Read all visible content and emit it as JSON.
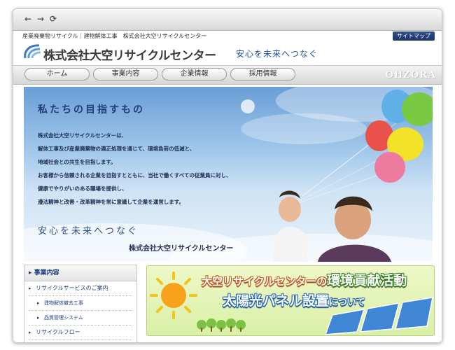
{
  "browser": {
    "back_icon": "arrow-left-icon",
    "forward_icon": "arrow-right-icon",
    "reload_icon": "reload-icon"
  },
  "header": {
    "tagline": "産業廃棄物リサイクル｜建物解体工事　株式会社大空リサイクルセンター",
    "sitemap_label": "サイトマップ",
    "company_name": "株式会社大空リサイクルセンター",
    "slogan": "安心を未来へつなぐ",
    "brand_logo_text": "OHZORA"
  },
  "nav": {
    "items": [
      {
        "label": "ホーム"
      },
      {
        "label": "事業内容"
      },
      {
        "label": "企業情報"
      },
      {
        "label": "採用情報"
      }
    ]
  },
  "hero": {
    "title": "私たちの目指すもの",
    "lines": [
      "株式会社大空リサイクルセンターは、",
      "解体工事及び産業廃棄物の適正処理を通じて、環境負荷の低減と、",
      "地域社会との共生を目指します。",
      "お客様から信頼される企業を目指すとともに、当社で働くすべての従業員に対し、",
      "健康でやりがいのある職場を提供し、",
      "遵法精神と改善・改革精神を常に意識して企業を運営します。"
    ],
    "slogan": "安心を未来へつなぐ",
    "company": "株式会社大空リサイクルセンター"
  },
  "sidebar": {
    "heading": "事業内容",
    "items": [
      {
        "label": "リサイクルサービスのご案内",
        "level": 1
      },
      {
        "label": "建物解体撤去工事",
        "level": 2
      },
      {
        "label": "品質管理システム",
        "level": 2
      },
      {
        "label": "リサイクルフロー",
        "level": 1
      }
    ]
  },
  "banner": {
    "line1_prefix": "大空リサイクルセンターの",
    "line1_highlight": "環境貢献活動",
    "line2_main": "太陽光パネル設置",
    "line2_suffix": "について"
  },
  "colors": {
    "accent": "#1d3f7c",
    "sky": "#9fc6ea",
    "banner_green": "#d9f0a6"
  }
}
